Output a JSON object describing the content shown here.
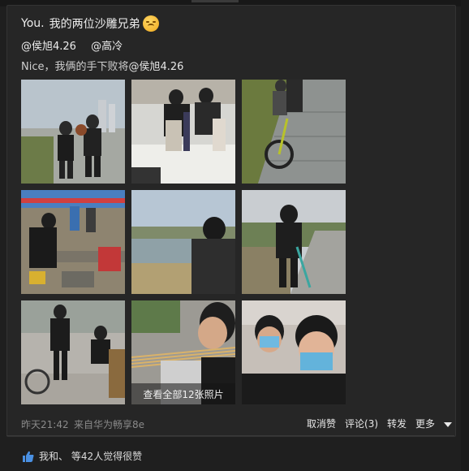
{
  "post": {
    "author": "You.",
    "text": "我的两位沙雕兄弟",
    "mentions": [
      "@侯旭4.26",
      "@高冷"
    ],
    "comment_prefix": "Nice，我俩的手下败将",
    "comment_mention": "@侯旭4.26"
  },
  "gallery": {
    "overlay_label": "查看全部12张照片"
  },
  "meta": {
    "time": "昨天21:42",
    "source": "来自华为畅享8e"
  },
  "actions": {
    "unlike": "取消赞",
    "comment": "评论(3)",
    "share": "转发",
    "more": "更多"
  },
  "likes": {
    "text": "我和、 等42人觉得很赞"
  },
  "icons": {
    "emoji": "upside-down-face-icon",
    "thumb": "thumbs-up-icon",
    "more": "caret-down-icon"
  },
  "colors": {
    "background": "#1f1f1f",
    "card": "#262626",
    "accent_blue": "#4a90e2"
  }
}
